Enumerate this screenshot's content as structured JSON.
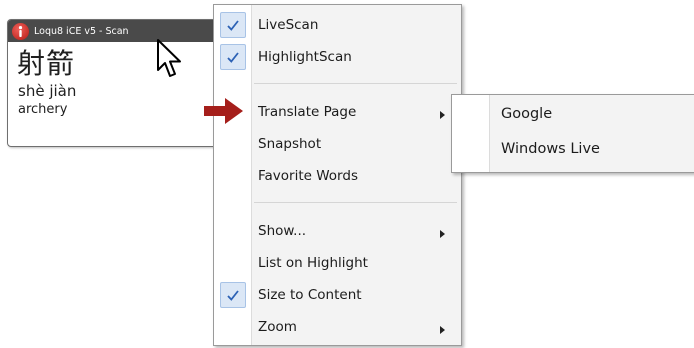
{
  "popup": {
    "title": "Loqu8 iCE v5 - Scan",
    "hanzi": "射箭",
    "pinyin": "shè jiàn",
    "definition": "archery"
  },
  "menu": {
    "items": [
      {
        "label": "LiveScan",
        "checked": true
      },
      {
        "label": "HighlightScan",
        "checked": true
      },
      {
        "label": "Translate Page",
        "submenu": true
      },
      {
        "label": "Snapshot"
      },
      {
        "label": "Favorite Words"
      },
      {
        "label": "Show...",
        "submenu": true
      },
      {
        "label": "List on Highlight"
      },
      {
        "label": "Size to Content",
        "checked": true
      },
      {
        "label": "Zoom",
        "submenu": true
      }
    ]
  },
  "submenu": {
    "items": [
      {
        "label": "Google"
      },
      {
        "label": "Windows Live"
      }
    ]
  },
  "icons": {
    "check": "check-icon",
    "submenu_arrow": "submenu-arrow-icon",
    "cursor": "mouse-cursor-icon",
    "pointer": "red-arrow-icon"
  },
  "colors": {
    "titlebar": "#4a4a4a",
    "check_highlight": "#dbe7f6",
    "check_mark": "#2d62b5",
    "pointer": "#a51f1b"
  }
}
